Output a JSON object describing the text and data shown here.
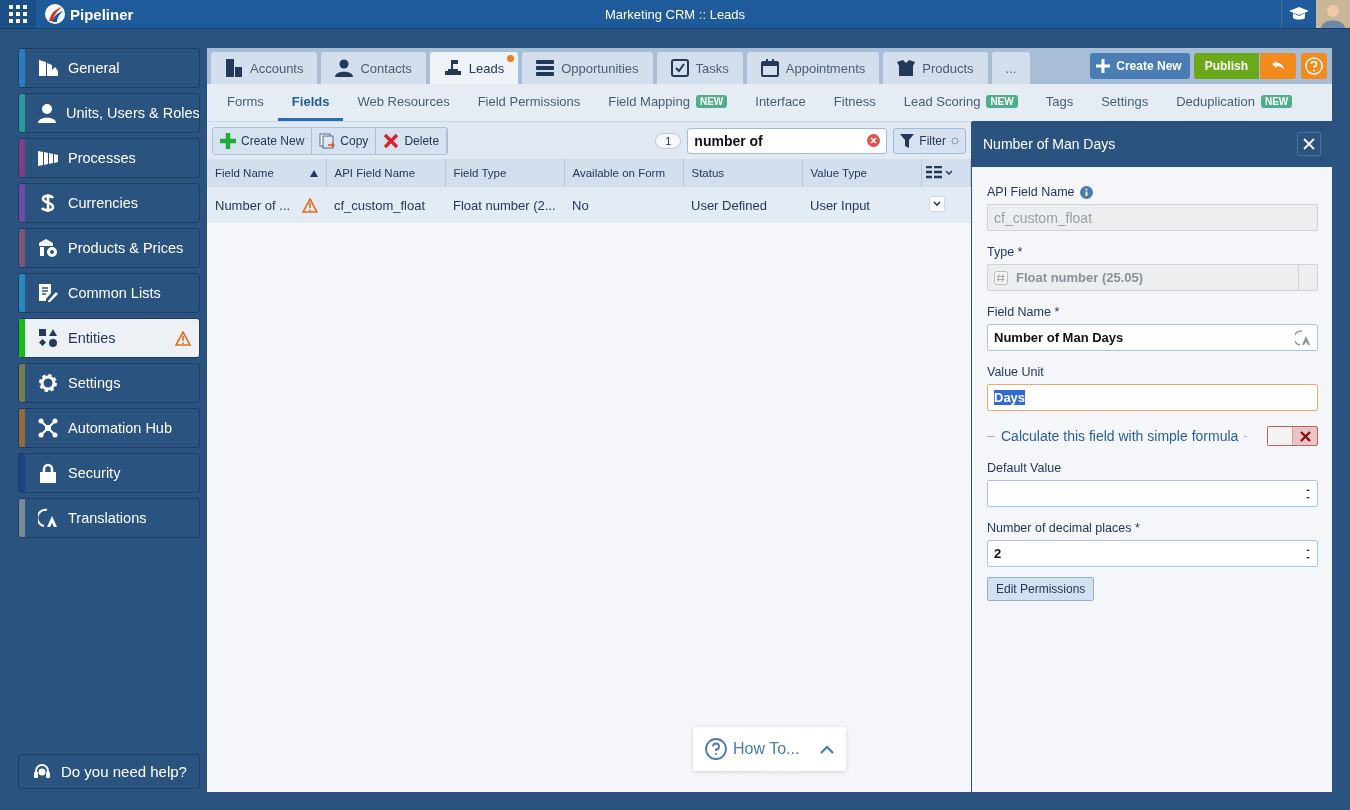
{
  "app": {
    "logo": "Pipeliner",
    "title": "Marketing CRM :: Leads"
  },
  "sidebar": {
    "items": [
      {
        "label": "General",
        "color": "#2a7bbf",
        "selected": false,
        "warning": false
      },
      {
        "label": "Units, Users & Roles",
        "color": "#2a9a9a",
        "selected": false,
        "warning": false
      },
      {
        "label": "Processes",
        "color": "#7a3f85",
        "selected": false,
        "warning": false
      },
      {
        "label": "Currencies",
        "color": "#6e4aa5",
        "selected": false,
        "warning": false
      },
      {
        "label": "Products & Prices",
        "color": "#7a5575",
        "selected": false,
        "warning": false
      },
      {
        "label": "Common Lists",
        "color": "#2a88c0",
        "selected": false,
        "warning": false
      },
      {
        "label": "Entities",
        "color": "#13c013",
        "selected": true,
        "warning": true
      },
      {
        "label": "Settings",
        "color": "#7a7a50",
        "selected": false,
        "warning": false
      },
      {
        "label": "Automation Hub",
        "color": "#946a38",
        "selected": false,
        "warning": false
      },
      {
        "label": "Security",
        "color": "#213f87",
        "selected": false,
        "warning": false
      },
      {
        "label": "Translations",
        "color": "#7a8a95",
        "selected": false,
        "warning": false
      }
    ],
    "help": "Do you need help?"
  },
  "tabs": [
    {
      "label": "Accounts",
      "selected": false,
      "notification": false
    },
    {
      "label": "Contacts",
      "selected": false,
      "notification": false
    },
    {
      "label": "Leads",
      "selected": true,
      "notification": true
    },
    {
      "label": "Opportunities",
      "selected": false,
      "notification": false
    },
    {
      "label": "Tasks",
      "selected": false,
      "notification": false
    },
    {
      "label": "Appointments",
      "selected": false,
      "notification": false
    },
    {
      "label": "Products",
      "selected": false,
      "notification": false
    },
    {
      "label": "...",
      "selected": false,
      "notification": false
    }
  ],
  "actions": {
    "create_new": "Create New",
    "publish": "Publish"
  },
  "subtabs": [
    {
      "label": "Forms",
      "selected": false
    },
    {
      "label": "Fields",
      "selected": true
    },
    {
      "label": "Web Resources",
      "selected": false
    },
    {
      "label": "Field Permissions",
      "selected": false
    },
    {
      "label": "Field Mapping",
      "selected": false,
      "badge": "NEW"
    },
    {
      "label": "Interface",
      "selected": false
    },
    {
      "label": "Fitness",
      "selected": false
    },
    {
      "label": "Lead Scoring",
      "selected": false,
      "badge": "NEW"
    },
    {
      "label": "Tags",
      "selected": false
    },
    {
      "label": "Settings",
      "selected": false
    },
    {
      "label": "Deduplication",
      "selected": false,
      "badge": "NEW"
    }
  ],
  "toolbar": {
    "buttons": [
      "Create New",
      "Copy",
      "Delete"
    ],
    "count": "1",
    "search": "number of",
    "filter": "Filter"
  },
  "table": {
    "columns": [
      {
        "label": "Field Name",
        "sorted": true
      },
      {
        "label": "API Field Name",
        "sorted": false
      },
      {
        "label": "Field Type",
        "sorted": false
      },
      {
        "label": "Available on Form",
        "sorted": false
      },
      {
        "label": "Status",
        "sorted": false
      },
      {
        "label": "Value Type",
        "sorted": false
      }
    ],
    "rows": [
      {
        "cells": [
          "Number of ...",
          "cf_custom_float",
          "Float number (2...",
          "No",
          "User Defined",
          "User Input"
        ],
        "warning": true,
        "selected": true
      }
    ]
  },
  "panel": {
    "title": "Number of Man Days",
    "fields": [
      {
        "kind": "readonly",
        "label": "API Field Name",
        "value": "cf_custom_float"
      },
      {
        "kind": "select",
        "label": "Type *",
        "value": "Float number (25.05)"
      },
      {
        "kind": "text",
        "label": "Field Name *",
        "value": "Number of Man Days"
      },
      {
        "kind": "focused",
        "label": "Value Unit",
        "value": "Days"
      },
      {
        "kind": "toggle",
        "label": "Calculate this field with simple formula",
        "on": false
      },
      {
        "kind": "number",
        "label": "Default Value"
      },
      {
        "kind": "number",
        "label": "Number of decimal places *",
        "value": "2"
      }
    ],
    "button": "Edit Permissions"
  },
  "how_to": "How To..."
}
